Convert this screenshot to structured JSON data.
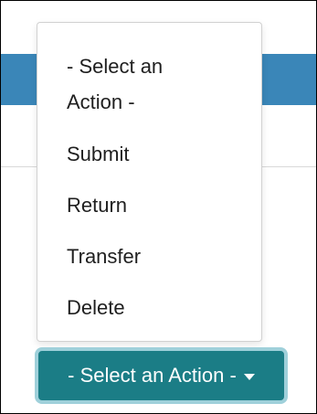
{
  "dropdown": {
    "items": [
      "- Select an Action -",
      "Submit",
      "Return",
      "Transfer",
      "Delete"
    ]
  },
  "button": {
    "label": "- Select an Action -",
    "icon": "caret-down-icon"
  },
  "colors": {
    "header_band": "#3a86b8",
    "button_background": "#1b7d86",
    "button_focus_ring": "#9fd0da",
    "menu_text": "#1f1f1f"
  }
}
